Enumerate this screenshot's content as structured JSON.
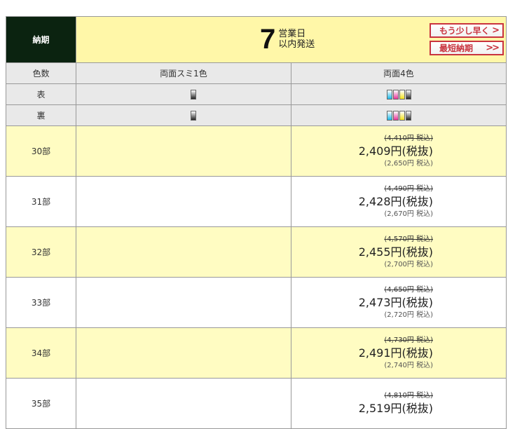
{
  "header": {
    "label": "納期",
    "days": "7",
    "line1": "営業日",
    "line2": "以内発送",
    "faster_button": "もう少し早く",
    "faster_chevron": ">",
    "fastest_button": "最短納期",
    "fastest_chevron": ">>"
  },
  "colors_row": {
    "label": "色数",
    "col1": "両面スミ1色",
    "col2": "両面4色"
  },
  "front_row": {
    "label": "表"
  },
  "back_row": {
    "label": "裏"
  },
  "rows": [
    {
      "qty": "30部",
      "struck": "(4,410円 税込)",
      "price": "2,409円(税抜)",
      "taxin": "(2,650円 税込)"
    },
    {
      "qty": "31部",
      "struck": "(4,490円 税込)",
      "price": "2,428円(税抜)",
      "taxin": "(2,670円 税込)"
    },
    {
      "qty": "32部",
      "struck": "(4,570円 税込)",
      "price": "2,455円(税抜)",
      "taxin": "(2,700円 税込)"
    },
    {
      "qty": "33部",
      "struck": "(4,650円 税込)",
      "price": "2,473円(税抜)",
      "taxin": "(2,720円 税込)"
    },
    {
      "qty": "34部",
      "struck": "(4,730円 税込)",
      "price": "2,491円(税抜)",
      "taxin": "(2,740円 税込)"
    },
    {
      "qty": "35部",
      "struck": "(4,810円 税込)",
      "price": "2,519円(税抜)",
      "taxin": ""
    }
  ],
  "ink_icons": {
    "mono": [
      "black-ink-icon"
    ],
    "four": [
      "cyan-ink-icon",
      "magenta-ink-icon",
      "yellow-ink-icon",
      "black-ink-icon"
    ]
  },
  "colors": {
    "header_dark": "#0b2310",
    "header_yellow": "#fff7a8",
    "row_yellow": "#fffcc2",
    "button_red": "#c9333e",
    "gray_row": "#e9e9e9"
  }
}
